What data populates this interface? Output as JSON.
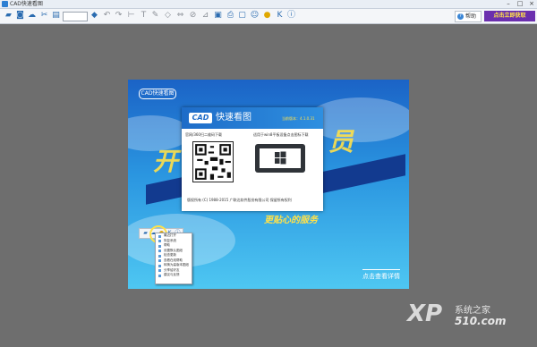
{
  "window": {
    "title": "CAD快速看图",
    "min": "–",
    "max": "□",
    "close": "×"
  },
  "toolbar": {
    "icons": [
      "open-folder-icon",
      "save-icon",
      "cloud-icon",
      "cut-icon",
      "file-icon",
      "zoom-box",
      "layers-icon",
      "undo-icon",
      "redo-icon",
      "dimension-icon",
      "text-icon",
      "pen-icon",
      "eraser-icon",
      "compare-icon",
      "hide-icon",
      "measure-icon",
      "area-icon",
      "print-icon",
      "screenshot-icon",
      "layout-icon",
      "user-icon",
      "vip-icon",
      "k-icon",
      "info-icon"
    ],
    "help_label": "帮助",
    "promo_label": "点击立即获取"
  },
  "about": {
    "app_name": "快速看图",
    "logo_text": "CAD",
    "version": "当前版本：4.1.0.31",
    "left_caption": "官网/360扫二维码下载",
    "right_caption": "适用于win8平板设备点击图标下载",
    "copyright": "版权所有 (C) 1988-2015 广联达软件股份有限公司 保留所有权利"
  },
  "canvas": {
    "badge": "CAD快速看图",
    "slogan": "更贴心的服务",
    "detail_link": "点击查看详情",
    "big_text_1": "开",
    "big_text_2": "员"
  },
  "context_menu": {
    "items": [
      "最近打开",
      "恢复系统",
      "帮助",
      "设置默认图纸",
      "检查更新",
      "查看在线帮助",
      "转换为高版本图纸",
      "分享给好友",
      "建议与反馈"
    ]
  },
  "watermark": {
    "brand": "XP",
    "sub": "系统之家",
    "url": "510.com"
  }
}
